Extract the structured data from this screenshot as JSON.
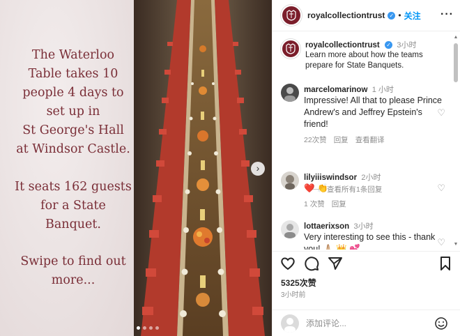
{
  "media": {
    "caption_lines_1": [
      "The Waterloo",
      "Table takes 10",
      "people 4 days to",
      "set up in",
      "St George's Hall",
      "at Windsor Castle."
    ],
    "caption_lines_2": [
      "It seats 162 guests",
      "for a State",
      "Banquet."
    ],
    "caption_lines_3": [
      "Swipe to find out",
      "more..."
    ],
    "next_glyph": "›",
    "slide_count": 4,
    "active_slide": 0
  },
  "header": {
    "username": "royalcollectiontrust",
    "verified_glyph": "✓",
    "separator": "•",
    "follow_label": "关注",
    "more_glyph": "···"
  },
  "caption_comment": {
    "username": "royalcollectiontrust",
    "time": "3小时",
    "text": "Learn more about how the teams prepare for State Banquets."
  },
  "comments": [
    {
      "username": "marcelomarinow",
      "time": "1 小时",
      "text": "Impressive! All that to please Prince Andrew's and Jeffrey Epstein's friend!",
      "likes": "22次赞",
      "reply": "回复",
      "translate": "查看翻译"
    },
    {
      "username": "lilyiiiswindsor",
      "time": "2小时",
      "text": "❤️ 👏",
      "likes": "1 次赞",
      "reply": "回复"
    },
    {
      "username": "lottaerixson",
      "time": "3小时",
      "text": "Very interesting to see this - thank you! 🙏🏼 👑 💕"
    }
  ],
  "view_replies": "查看所有1条回复",
  "like_glyph": "♡",
  "likes_count": "5325次赞",
  "posted_time": "3小时前",
  "add_comment": {
    "placeholder": "添加评论..."
  },
  "colors": {
    "brand": "#7b1e2b",
    "caption_text": "#7a2e37",
    "link_blue": "#0095f6",
    "verified": "#3897f0"
  }
}
